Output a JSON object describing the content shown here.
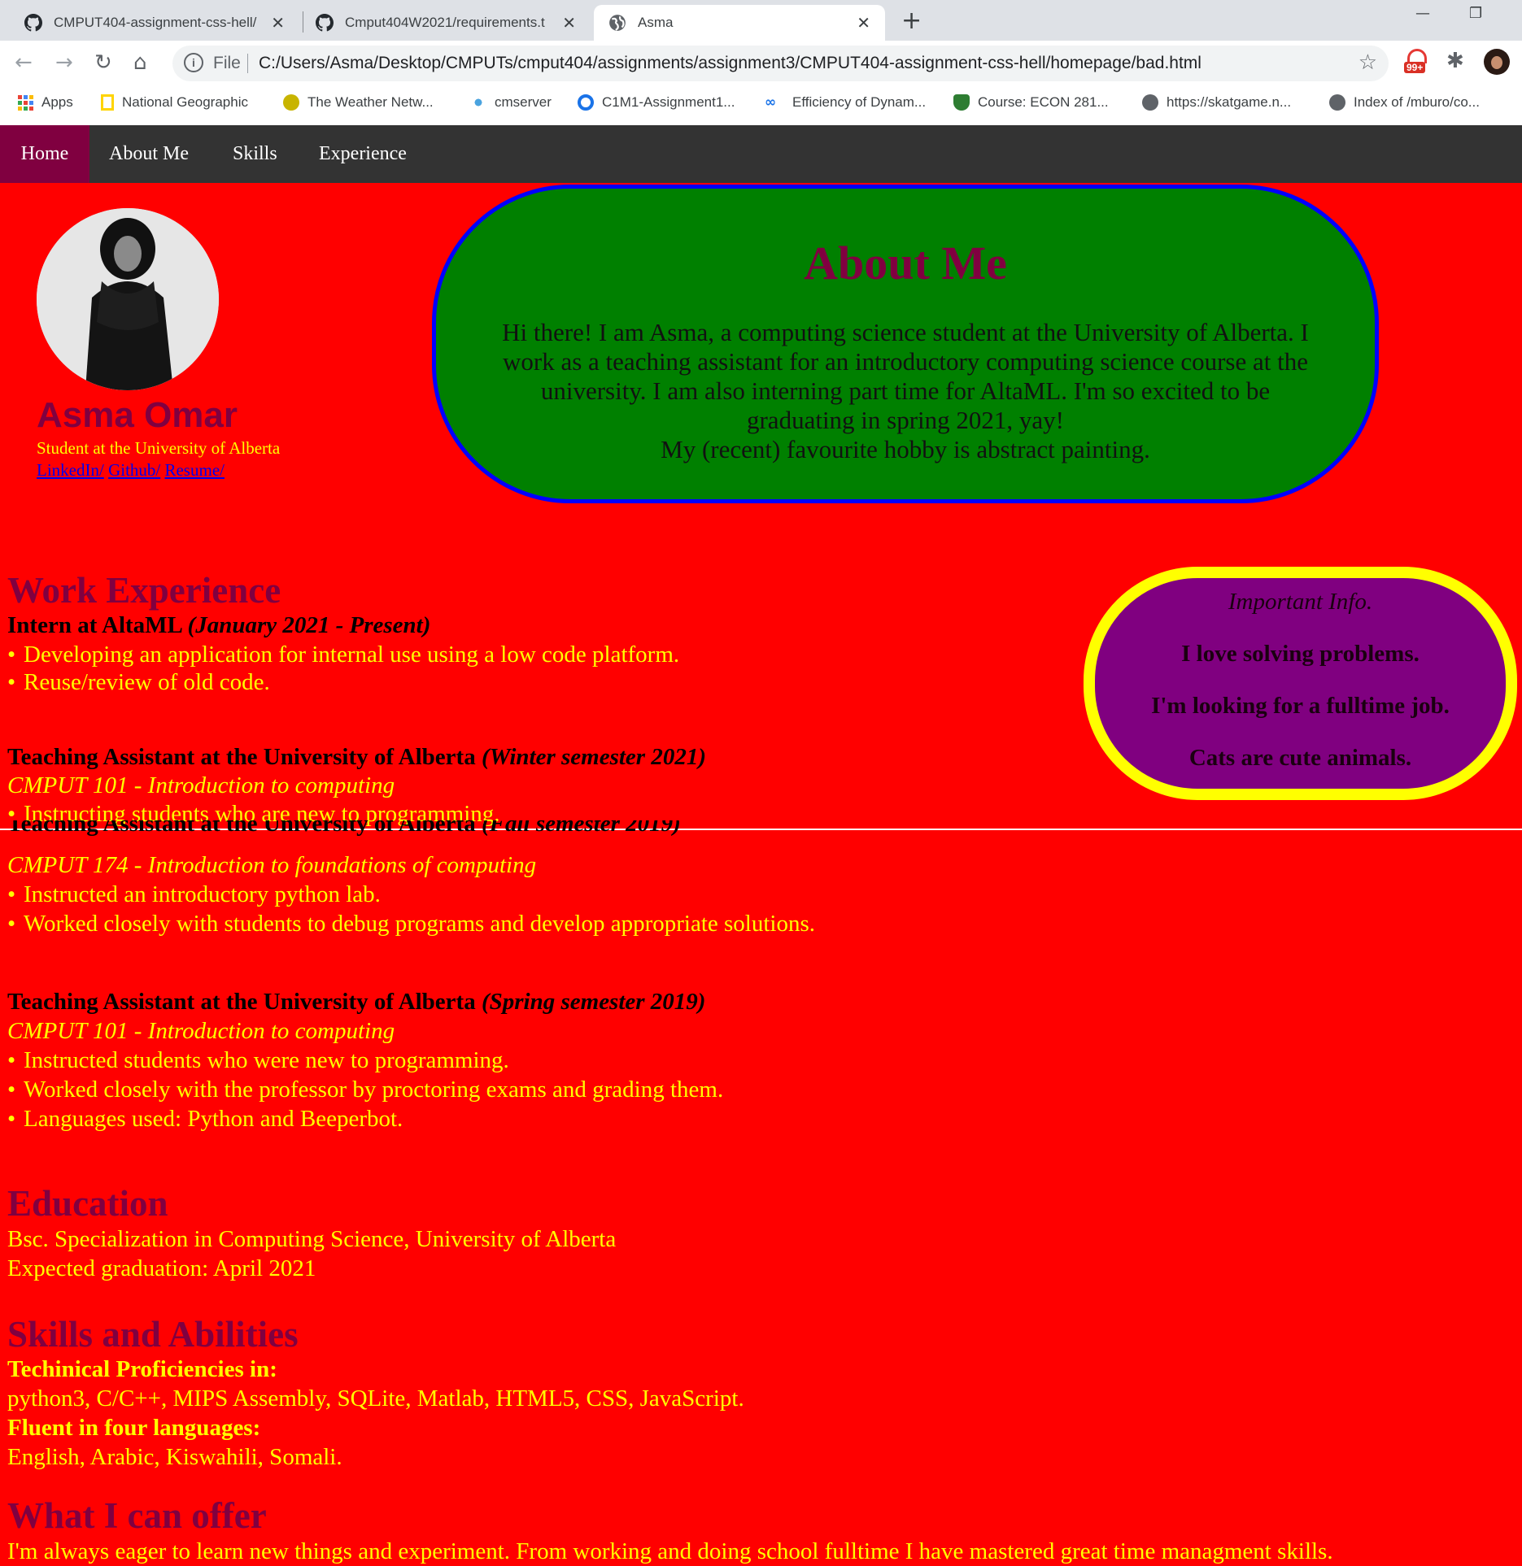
{
  "browser": {
    "tabs": [
      {
        "title": "CMPUT404-assignment-css-hell/",
        "icon": "github-icon"
      },
      {
        "title": "Cmput404W2021/requirements.t",
        "icon": "github-icon"
      },
      {
        "title": "Asma",
        "icon": "globe-icon",
        "active": true
      }
    ],
    "new_tab": "+",
    "address": {
      "scheme": "File",
      "url": "C:/Users/Asma/Desktop/CMPUTs/cmput404/assignments/assignment3/CMPUT404-assignment-css-hell/homepage/bad.html"
    },
    "extension_badge": "99+",
    "bookmarks": [
      {
        "label": "Apps",
        "color": "#4285f4"
      },
      {
        "label": "National Geographic",
        "color": "#ffd400"
      },
      {
        "label": "The Weather Netw...",
        "color": "#c8b400"
      },
      {
        "label": "cmserver",
        "color": "#4aa3df"
      },
      {
        "label": "C1M1-Assignment1...",
        "color": "#1a73e8"
      },
      {
        "label": "Efficiency of Dynam...",
        "color": "#1a73e8"
      },
      {
        "label": "Course: ECON 281...",
        "color": "#2e7d32"
      },
      {
        "label": "https://skatgame.n...",
        "color": "#5f6368"
      },
      {
        "label": "Index of /mburo/co...",
        "color": "#5f6368"
      }
    ]
  },
  "nav": {
    "items": [
      "Home",
      "About Me",
      "Skills",
      "Experience"
    ]
  },
  "profile": {
    "name": "Asma Omar",
    "subtitle": "Student at the University of Alberta",
    "links": [
      "LinkedIn/",
      "Github/",
      "Resume/"
    ]
  },
  "about": {
    "title": "About Me",
    "text": "Hi there! I am Asma, a computing science student at the University of Alberta. I work as a teaching assistant for an introductory computing science course at the university. I am also interning part time for AltaML. I'm so excited to be graduating in spring 2021, yay!",
    "hobby": "My (recent) favourite hobby is abstract painting."
  },
  "info": {
    "lines": [
      "Important Info.",
      "I love solving problems.",
      "I'm looking for a fulltime job.",
      "Cats are cute animals."
    ]
  },
  "work": {
    "title": "Work Experience",
    "jobs": [
      {
        "role": "Intern at AltaML",
        "period": "(January 2021 - Present)",
        "course": "",
        "bullets": [
          "Developing an application for internal use using a low code platform.",
          "Reuse/review of old code."
        ]
      },
      {
        "role": "Teaching Assistant at the University of Alberta",
        "period": "(Winter semester 2021)",
        "course": "CMPUT 101 - Introduction to computing",
        "bullets": [
          "Instructing students who are new to programming."
        ]
      },
      {
        "role": "Teaching Assistant at the University of Alberta",
        "period": "(Fall semester 2019)",
        "course": "CMPUT 174 - Introduction to foundations of computing",
        "bullets": [
          "Instructed an introductory python lab.",
          "Worked closely with students to debug programs and develop appropriate solutions."
        ]
      },
      {
        "role": "Teaching Assistant at the University of Alberta",
        "period": "(Spring semester 2019)",
        "course": "CMPUT 101 - Introduction to computing",
        "bullets": [
          "Instructed students who were new to programming.",
          "Worked closely with the professor by proctoring exams and grading them.",
          "Languages used: Python and Beeperbot."
        ]
      }
    ]
  },
  "education": {
    "title": "Education",
    "degree": "Bsc. Specialization in Computing Science, University of Alberta",
    "graduation": "Expected graduation: April 2021"
  },
  "skills": {
    "title": "Skills and Abilities",
    "tech_label": "Techinical Proficiencies in:",
    "tech_list": "python3, C/C++, MIPS Assembly, SQLite, Matlab, HTML5, CSS, JavaScript.",
    "lang_label": "Fluent in four languages:",
    "lang_list": "English, Arabic, Kiswahili, Somali."
  },
  "offer": {
    "title": "What I can offer",
    "text": "I'm always eager to learn new things and experiment. From working and doing school fulltime I have mastered great time managment skills."
  },
  "colors": {
    "page_bg": "#ff0000",
    "nav_bg": "#333333",
    "nav_active": "#800040",
    "about_bg": "#008000",
    "about_border": "#0000ff",
    "info_bg": "#800080",
    "info_border": "#ffff00",
    "heading": "#800040",
    "text": "#ffff00"
  }
}
